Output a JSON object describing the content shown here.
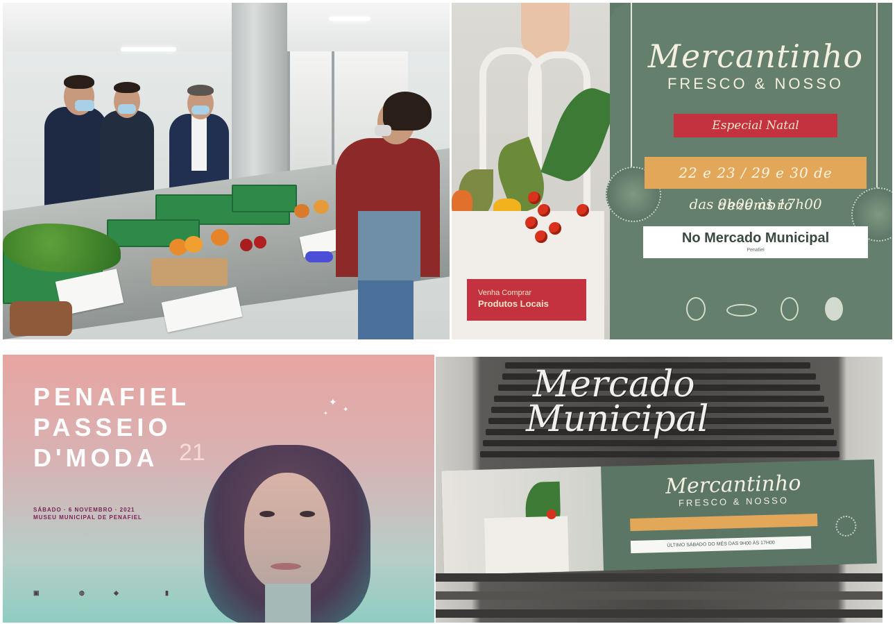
{
  "panel_market_photo": {},
  "panel_mercantinho": {
    "title": "Mercantinho",
    "subtitle": "FRESCO & NOSSO",
    "special": "Especial Natal",
    "dates": "22 e 23 / 29 e 30 de dezembro",
    "hours": "das 9h00 às 17h00",
    "venue": "No Mercado Municipal",
    "venue_address": "Penafiel",
    "tag_line1": "Venha Comprar",
    "tag_line2": "Produtos Locais"
  },
  "panel_penafiel": {
    "line1": "PENAFIEL",
    "line2": "PASSEIO",
    "line3": "D'MODA",
    "year": "21",
    "when_line1": "SÁBADO · 6 NOVEMBRO · 2021",
    "when_line2": "MUSEU MUNICIPAL DE PENAFIEL"
  },
  "panel_mercado": {
    "sign_line1": "Mercado",
    "sign_line2": "Municipal",
    "banner_title": "Mercantinho",
    "banner_subtitle": "FRESCO & NOSSO",
    "banner_strip": "ÚLTIMO SÁBADO DO MÊS DAS 9H00 ÀS 17H00"
  },
  "colors": {
    "poster_green": "#647f6b",
    "accent_red": "#c4313f",
    "accent_orange": "#e3a75a",
    "penafiel_pink": "#e7a5a0",
    "penafiel_teal": "#8ecdc1"
  }
}
